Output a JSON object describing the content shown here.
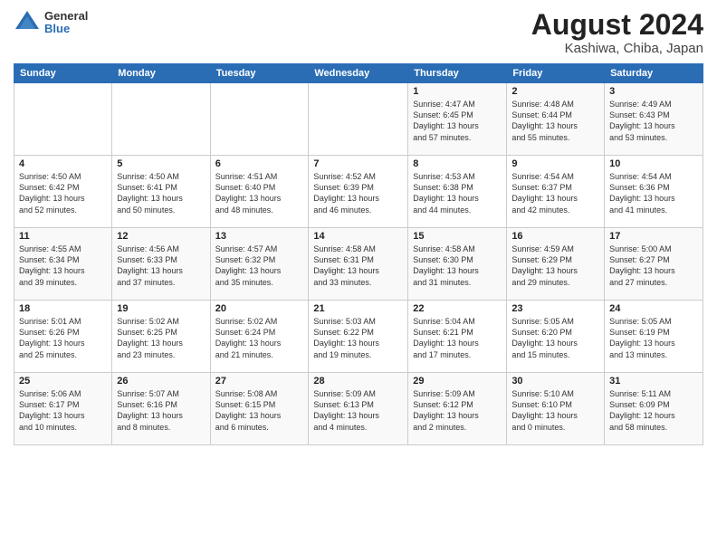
{
  "logo": {
    "general": "General",
    "blue": "Blue"
  },
  "title": "August 2024",
  "subtitle": "Kashiwa, Chiba, Japan",
  "days_of_week": [
    "Sunday",
    "Monday",
    "Tuesday",
    "Wednesday",
    "Thursday",
    "Friday",
    "Saturday"
  ],
  "weeks": [
    [
      {
        "day": "",
        "info": ""
      },
      {
        "day": "",
        "info": ""
      },
      {
        "day": "",
        "info": ""
      },
      {
        "day": "",
        "info": ""
      },
      {
        "day": "1",
        "info": "Sunrise: 4:47 AM\nSunset: 6:45 PM\nDaylight: 13 hours\nand 57 minutes."
      },
      {
        "day": "2",
        "info": "Sunrise: 4:48 AM\nSunset: 6:44 PM\nDaylight: 13 hours\nand 55 minutes."
      },
      {
        "day": "3",
        "info": "Sunrise: 4:49 AM\nSunset: 6:43 PM\nDaylight: 13 hours\nand 53 minutes."
      }
    ],
    [
      {
        "day": "4",
        "info": "Sunrise: 4:50 AM\nSunset: 6:42 PM\nDaylight: 13 hours\nand 52 minutes."
      },
      {
        "day": "5",
        "info": "Sunrise: 4:50 AM\nSunset: 6:41 PM\nDaylight: 13 hours\nand 50 minutes."
      },
      {
        "day": "6",
        "info": "Sunrise: 4:51 AM\nSunset: 6:40 PM\nDaylight: 13 hours\nand 48 minutes."
      },
      {
        "day": "7",
        "info": "Sunrise: 4:52 AM\nSunset: 6:39 PM\nDaylight: 13 hours\nand 46 minutes."
      },
      {
        "day": "8",
        "info": "Sunrise: 4:53 AM\nSunset: 6:38 PM\nDaylight: 13 hours\nand 44 minutes."
      },
      {
        "day": "9",
        "info": "Sunrise: 4:54 AM\nSunset: 6:37 PM\nDaylight: 13 hours\nand 42 minutes."
      },
      {
        "day": "10",
        "info": "Sunrise: 4:54 AM\nSunset: 6:36 PM\nDaylight: 13 hours\nand 41 minutes."
      }
    ],
    [
      {
        "day": "11",
        "info": "Sunrise: 4:55 AM\nSunset: 6:34 PM\nDaylight: 13 hours\nand 39 minutes."
      },
      {
        "day": "12",
        "info": "Sunrise: 4:56 AM\nSunset: 6:33 PM\nDaylight: 13 hours\nand 37 minutes."
      },
      {
        "day": "13",
        "info": "Sunrise: 4:57 AM\nSunset: 6:32 PM\nDaylight: 13 hours\nand 35 minutes."
      },
      {
        "day": "14",
        "info": "Sunrise: 4:58 AM\nSunset: 6:31 PM\nDaylight: 13 hours\nand 33 minutes."
      },
      {
        "day": "15",
        "info": "Sunrise: 4:58 AM\nSunset: 6:30 PM\nDaylight: 13 hours\nand 31 minutes."
      },
      {
        "day": "16",
        "info": "Sunrise: 4:59 AM\nSunset: 6:29 PM\nDaylight: 13 hours\nand 29 minutes."
      },
      {
        "day": "17",
        "info": "Sunrise: 5:00 AM\nSunset: 6:27 PM\nDaylight: 13 hours\nand 27 minutes."
      }
    ],
    [
      {
        "day": "18",
        "info": "Sunrise: 5:01 AM\nSunset: 6:26 PM\nDaylight: 13 hours\nand 25 minutes."
      },
      {
        "day": "19",
        "info": "Sunrise: 5:02 AM\nSunset: 6:25 PM\nDaylight: 13 hours\nand 23 minutes."
      },
      {
        "day": "20",
        "info": "Sunrise: 5:02 AM\nSunset: 6:24 PM\nDaylight: 13 hours\nand 21 minutes."
      },
      {
        "day": "21",
        "info": "Sunrise: 5:03 AM\nSunset: 6:22 PM\nDaylight: 13 hours\nand 19 minutes."
      },
      {
        "day": "22",
        "info": "Sunrise: 5:04 AM\nSunset: 6:21 PM\nDaylight: 13 hours\nand 17 minutes."
      },
      {
        "day": "23",
        "info": "Sunrise: 5:05 AM\nSunset: 6:20 PM\nDaylight: 13 hours\nand 15 minutes."
      },
      {
        "day": "24",
        "info": "Sunrise: 5:05 AM\nSunset: 6:19 PM\nDaylight: 13 hours\nand 13 minutes."
      }
    ],
    [
      {
        "day": "25",
        "info": "Sunrise: 5:06 AM\nSunset: 6:17 PM\nDaylight: 13 hours\nand 10 minutes."
      },
      {
        "day": "26",
        "info": "Sunrise: 5:07 AM\nSunset: 6:16 PM\nDaylight: 13 hours\nand 8 minutes."
      },
      {
        "day": "27",
        "info": "Sunrise: 5:08 AM\nSunset: 6:15 PM\nDaylight: 13 hours\nand 6 minutes."
      },
      {
        "day": "28",
        "info": "Sunrise: 5:09 AM\nSunset: 6:13 PM\nDaylight: 13 hours\nand 4 minutes."
      },
      {
        "day": "29",
        "info": "Sunrise: 5:09 AM\nSunset: 6:12 PM\nDaylight: 13 hours\nand 2 minutes."
      },
      {
        "day": "30",
        "info": "Sunrise: 5:10 AM\nSunset: 6:10 PM\nDaylight: 13 hours\nand 0 minutes."
      },
      {
        "day": "31",
        "info": "Sunrise: 5:11 AM\nSunset: 6:09 PM\nDaylight: 12 hours\nand 58 minutes."
      }
    ]
  ]
}
